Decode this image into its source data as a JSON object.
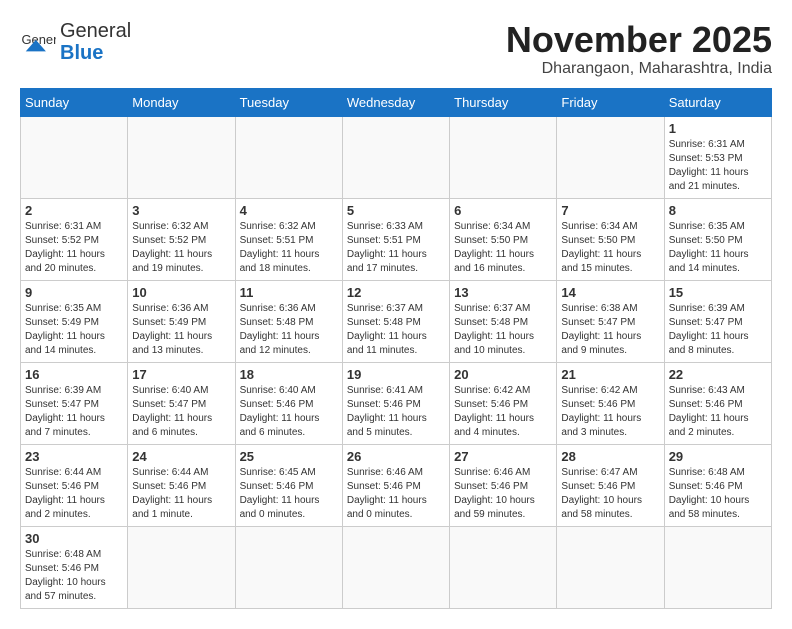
{
  "header": {
    "logo_general": "General",
    "logo_blue": "Blue",
    "month_title": "November 2025",
    "location": "Dharangaon, Maharashtra, India"
  },
  "weekdays": [
    "Sunday",
    "Monday",
    "Tuesday",
    "Wednesday",
    "Thursday",
    "Friday",
    "Saturday"
  ],
  "weeks": [
    [
      {
        "day": "",
        "info": ""
      },
      {
        "day": "",
        "info": ""
      },
      {
        "day": "",
        "info": ""
      },
      {
        "day": "",
        "info": ""
      },
      {
        "day": "",
        "info": ""
      },
      {
        "day": "",
        "info": ""
      },
      {
        "day": "1",
        "info": "Sunrise: 6:31 AM\nSunset: 5:53 PM\nDaylight: 11 hours and 21 minutes."
      }
    ],
    [
      {
        "day": "2",
        "info": "Sunrise: 6:31 AM\nSunset: 5:52 PM\nDaylight: 11 hours and 20 minutes."
      },
      {
        "day": "3",
        "info": "Sunrise: 6:32 AM\nSunset: 5:52 PM\nDaylight: 11 hours and 19 minutes."
      },
      {
        "day": "4",
        "info": "Sunrise: 6:32 AM\nSunset: 5:51 PM\nDaylight: 11 hours and 18 minutes."
      },
      {
        "day": "5",
        "info": "Sunrise: 6:33 AM\nSunset: 5:51 PM\nDaylight: 11 hours and 17 minutes."
      },
      {
        "day": "6",
        "info": "Sunrise: 6:34 AM\nSunset: 5:50 PM\nDaylight: 11 hours and 16 minutes."
      },
      {
        "day": "7",
        "info": "Sunrise: 6:34 AM\nSunset: 5:50 PM\nDaylight: 11 hours and 15 minutes."
      },
      {
        "day": "8",
        "info": "Sunrise: 6:35 AM\nSunset: 5:50 PM\nDaylight: 11 hours and 14 minutes."
      }
    ],
    [
      {
        "day": "9",
        "info": "Sunrise: 6:35 AM\nSunset: 5:49 PM\nDaylight: 11 hours and 14 minutes."
      },
      {
        "day": "10",
        "info": "Sunrise: 6:36 AM\nSunset: 5:49 PM\nDaylight: 11 hours and 13 minutes."
      },
      {
        "day": "11",
        "info": "Sunrise: 6:36 AM\nSunset: 5:48 PM\nDaylight: 11 hours and 12 minutes."
      },
      {
        "day": "12",
        "info": "Sunrise: 6:37 AM\nSunset: 5:48 PM\nDaylight: 11 hours and 11 minutes."
      },
      {
        "day": "13",
        "info": "Sunrise: 6:37 AM\nSunset: 5:48 PM\nDaylight: 11 hours and 10 minutes."
      },
      {
        "day": "14",
        "info": "Sunrise: 6:38 AM\nSunset: 5:47 PM\nDaylight: 11 hours and 9 minutes."
      },
      {
        "day": "15",
        "info": "Sunrise: 6:39 AM\nSunset: 5:47 PM\nDaylight: 11 hours and 8 minutes."
      }
    ],
    [
      {
        "day": "16",
        "info": "Sunrise: 6:39 AM\nSunset: 5:47 PM\nDaylight: 11 hours and 7 minutes."
      },
      {
        "day": "17",
        "info": "Sunrise: 6:40 AM\nSunset: 5:47 PM\nDaylight: 11 hours and 6 minutes."
      },
      {
        "day": "18",
        "info": "Sunrise: 6:40 AM\nSunset: 5:46 PM\nDaylight: 11 hours and 6 minutes."
      },
      {
        "day": "19",
        "info": "Sunrise: 6:41 AM\nSunset: 5:46 PM\nDaylight: 11 hours and 5 minutes."
      },
      {
        "day": "20",
        "info": "Sunrise: 6:42 AM\nSunset: 5:46 PM\nDaylight: 11 hours and 4 minutes."
      },
      {
        "day": "21",
        "info": "Sunrise: 6:42 AM\nSunset: 5:46 PM\nDaylight: 11 hours and 3 minutes."
      },
      {
        "day": "22",
        "info": "Sunrise: 6:43 AM\nSunset: 5:46 PM\nDaylight: 11 hours and 2 minutes."
      }
    ],
    [
      {
        "day": "23",
        "info": "Sunrise: 6:44 AM\nSunset: 5:46 PM\nDaylight: 11 hours and 2 minutes."
      },
      {
        "day": "24",
        "info": "Sunrise: 6:44 AM\nSunset: 5:46 PM\nDaylight: 11 hours and 1 minute."
      },
      {
        "day": "25",
        "info": "Sunrise: 6:45 AM\nSunset: 5:46 PM\nDaylight: 11 hours and 0 minutes."
      },
      {
        "day": "26",
        "info": "Sunrise: 6:46 AM\nSunset: 5:46 PM\nDaylight: 11 hours and 0 minutes."
      },
      {
        "day": "27",
        "info": "Sunrise: 6:46 AM\nSunset: 5:46 PM\nDaylight: 10 hours and 59 minutes."
      },
      {
        "day": "28",
        "info": "Sunrise: 6:47 AM\nSunset: 5:46 PM\nDaylight: 10 hours and 58 minutes."
      },
      {
        "day": "29",
        "info": "Sunrise: 6:48 AM\nSunset: 5:46 PM\nDaylight: 10 hours and 58 minutes."
      }
    ],
    [
      {
        "day": "30",
        "info": "Sunrise: 6:48 AM\nSunset: 5:46 PM\nDaylight: 10 hours and 57 minutes."
      },
      {
        "day": "",
        "info": ""
      },
      {
        "day": "",
        "info": ""
      },
      {
        "day": "",
        "info": ""
      },
      {
        "day": "",
        "info": ""
      },
      {
        "day": "",
        "info": ""
      },
      {
        "day": "",
        "info": ""
      }
    ]
  ]
}
